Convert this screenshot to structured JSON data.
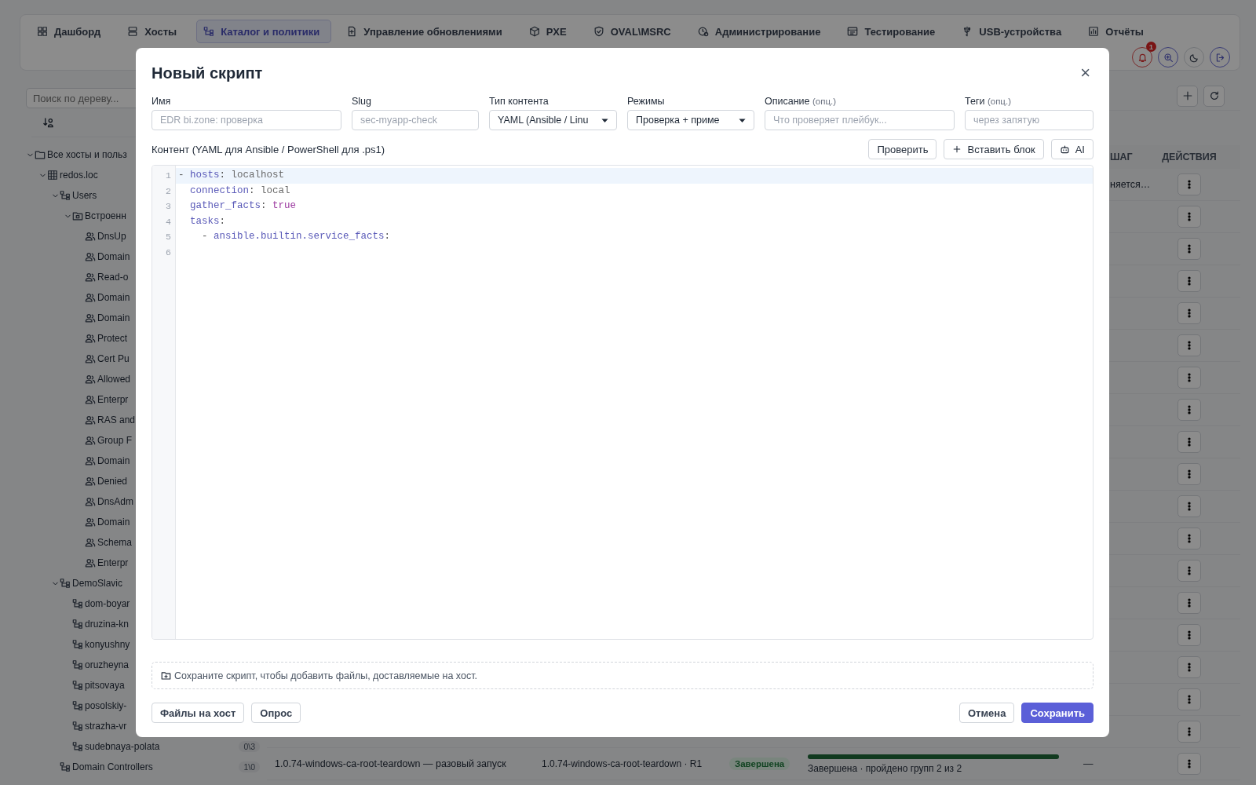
{
  "nav": {
    "tabs": [
      {
        "label": "Дашборд",
        "selected": false
      },
      {
        "label": "Хосты",
        "selected": false
      },
      {
        "label": "Каталог и политики",
        "selected": true
      },
      {
        "label": "Управление обновлениями",
        "selected": false
      },
      {
        "label": "PXE",
        "selected": false
      },
      {
        "label": "OVAL\\MSRC",
        "selected": false
      },
      {
        "label": "Администрирование",
        "selected": false
      },
      {
        "label": "Тестирование",
        "selected": false
      },
      {
        "label": "USB-устройства",
        "selected": false
      },
      {
        "label": "Отчёты",
        "selected": false
      }
    ],
    "alerts_count": "1"
  },
  "sidebar": {
    "search_placeholder": "Поиск по дереву...",
    "tree": [
      {
        "label": "Все хосты и польз",
        "kind": "folder",
        "expanded": true,
        "children": [
          {
            "label": "redos.loc",
            "kind": "domain",
            "expanded": true,
            "children": [
              {
                "label": "Users",
                "kind": "ou",
                "expanded": true,
                "children": [
                  {
                    "label": "Встроенн",
                    "kind": "builtin",
                    "expanded": true,
                    "children": [
                      {
                        "label": "DnsUp",
                        "kind": "group"
                      },
                      {
                        "label": "Domain",
                        "kind": "group"
                      },
                      {
                        "label": "Read-o",
                        "kind": "group"
                      },
                      {
                        "label": "Domain",
                        "kind": "group"
                      },
                      {
                        "label": "Domain",
                        "kind": "group"
                      },
                      {
                        "label": "Protect",
                        "kind": "group"
                      },
                      {
                        "label": "Cert Pu",
                        "kind": "group"
                      },
                      {
                        "label": "Allowed",
                        "kind": "group"
                      },
                      {
                        "label": "Enterpr",
                        "kind": "group"
                      },
                      {
                        "label": "RAS and",
                        "kind": "group"
                      },
                      {
                        "label": "Group F",
                        "kind": "group"
                      },
                      {
                        "label": "Domain",
                        "kind": "group"
                      },
                      {
                        "label": "Denied",
                        "kind": "group"
                      },
                      {
                        "label": "DnsAdm",
                        "kind": "group"
                      },
                      {
                        "label": "Domain",
                        "kind": "group"
                      },
                      {
                        "label": "Schema",
                        "kind": "group"
                      },
                      {
                        "label": "Enterpr",
                        "kind": "group"
                      }
                    ]
                  }
                ]
              },
              {
                "label": "DemoSlavic",
                "kind": "ou",
                "expanded": true,
                "children": [
                  {
                    "label": "dom-boyar",
                    "kind": "ou"
                  },
                  {
                    "label": "druzina-kn",
                    "kind": "ou"
                  },
                  {
                    "label": "konyushny",
                    "kind": "ou"
                  },
                  {
                    "label": "oruzheyna",
                    "kind": "ou"
                  },
                  {
                    "label": "pitsovaya",
                    "kind": "ou"
                  },
                  {
                    "label": "posolskiy-",
                    "kind": "ou"
                  },
                  {
                    "label": "strazha-vr",
                    "kind": "ou"
                  },
                  {
                    "label": "sudebnaya-polata",
                    "kind": "ou",
                    "badge": "0\\3"
                  }
                ]
              },
              {
                "label": "Domain Controllers",
                "kind": "ou",
                "badge": "1\\0"
              }
            ]
          }
        ]
      }
    ]
  },
  "table": {
    "columns": [
      {
        "label": "ШАГ"
      },
      {
        "label": "ДЕЙСТВИЯ"
      }
    ],
    "rows": [
      {
        "kind": "covered",
        "step": "няется…"
      },
      {
        "kind": "covered"
      },
      {
        "kind": "covered"
      },
      {
        "kind": "covered"
      },
      {
        "kind": "covered"
      },
      {
        "kind": "covered"
      },
      {
        "kind": "covered"
      },
      {
        "kind": "covered"
      },
      {
        "kind": "covered"
      },
      {
        "kind": "covered"
      },
      {
        "kind": "covered"
      },
      {
        "kind": "covered"
      },
      {
        "kind": "covered"
      },
      {
        "kind": "covered"
      },
      {
        "kind": "covered"
      },
      {
        "kind": "covered"
      },
      {
        "kind": "covered"
      },
      {
        "kind": "covered"
      },
      {
        "kind": "full",
        "name": "1.0.74-windows-ca-root-teardown — разовый запуск",
        "version": "1.0.74-windows-ca-root-teardown · R1",
        "status": "Завершена",
        "level": 1,
        "progress_text": "Завершена · пройдено групп 2 из 2",
        "extra": "—"
      }
    ]
  },
  "dialog": {
    "title": "Новый скрипт",
    "close": "×",
    "fields": [
      {
        "kind": "text",
        "label": "Имя",
        "placeholder": "EDR bi.zone: проверка"
      },
      {
        "kind": "text",
        "label": "Slug",
        "placeholder": "sec-myapp-check"
      },
      {
        "kind": "select",
        "label": "Тип контента",
        "value": "YAML (Ansible / Linu"
      },
      {
        "kind": "select",
        "label": "Режимы",
        "value": "Проверка + приме"
      },
      {
        "kind": "text",
        "label": "Описание",
        "hint": "(опц.)",
        "placeholder": "Что проверяет плейбук..."
      },
      {
        "kind": "text",
        "label": "Теги",
        "hint": "(опц.)",
        "placeholder": "через запятую"
      }
    ],
    "content_label": "Контент (YAML для Ansible / PowerShell для .ps1)",
    "tools": [
      {
        "label": "Проверить"
      },
      {
        "label": "Вставить блок"
      },
      {
        "label": "AI"
      }
    ],
    "editor": {
      "lines": [
        {
          "number": "1",
          "active": true,
          "tokens": [
            {
              "text": "- ",
              "kind": "punct"
            },
            {
              "text": "hosts",
              "kind": "key"
            },
            {
              "text": ": ",
              "kind": "punct"
            },
            {
              "text": "localhost",
              "kind": "plain"
            }
          ]
        },
        {
          "number": "2",
          "active": false,
          "tokens": [
            {
              "text": "  connection",
              "kind": "key"
            },
            {
              "text": ": ",
              "kind": "punct"
            },
            {
              "text": "local",
              "kind": "plain"
            }
          ]
        },
        {
          "number": "3",
          "active": false,
          "tokens": [
            {
              "text": "  gather_facts",
              "kind": "key"
            },
            {
              "text": ": ",
              "kind": "punct"
            },
            {
              "text": "true",
              "kind": "bool"
            }
          ]
        },
        {
          "number": "4",
          "active": false,
          "tokens": [
            {
              "text": "  tasks",
              "kind": "key"
            },
            {
              "text": ":",
              "kind": "punct"
            }
          ]
        },
        {
          "number": "5",
          "active": false,
          "tokens": [
            {
              "text": "    - ",
              "kind": "punct"
            },
            {
              "text": "ansible.builtin.service_facts",
              "kind": "key"
            },
            {
              "text": ":",
              "kind": "punct"
            }
          ]
        },
        {
          "number": "6",
          "active": false
        }
      ]
    },
    "notice": "Сохраните скрипт, чтобы добавить файлы, доставляемые на хост.",
    "footer_left": [
      {
        "label": "Файлы на хост"
      },
      {
        "label": "Опрос"
      }
    ],
    "footer_right": [
      {
        "label": "Отмена",
        "kind": "secondary"
      },
      {
        "label": "Сохранить",
        "kind": "primary"
      }
    ]
  }
}
